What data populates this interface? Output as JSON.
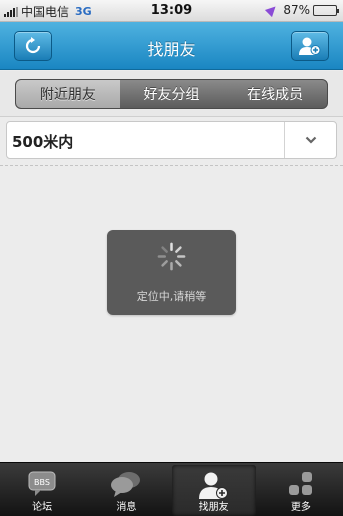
{
  "status_bar": {
    "carrier": "中国电信",
    "network": "3G",
    "time": "13:09",
    "battery_text": "87%",
    "battery_level": 0.87
  },
  "nav": {
    "title": "找朋友",
    "left_icon": "refresh-icon",
    "right_icon": "add-contact-icon"
  },
  "segments": [
    {
      "label": "附近朋友",
      "active": true
    },
    {
      "label": "好友分组",
      "active": false
    },
    {
      "label": "在线成员",
      "active": false
    }
  ],
  "range": {
    "selected": "500米内",
    "icon": "chevron-down-icon"
  },
  "loading": {
    "text": "定位中,请稍等",
    "icon": "spinner-icon"
  },
  "tabs": [
    {
      "label": "论坛",
      "icon": "bbs-icon",
      "icon_text": "BBS",
      "active": false
    },
    {
      "label": "消息",
      "icon": "chat-bubbles-icon",
      "active": false
    },
    {
      "label": "找朋友",
      "icon": "find-friend-icon",
      "active": true
    },
    {
      "label": "更多",
      "icon": "more-grid-icon",
      "active": false
    }
  ],
  "colors": {
    "nav_blue": "#1a86c2",
    "tab_bar": "#1e1e1e",
    "toast": "#5a5a5a"
  }
}
